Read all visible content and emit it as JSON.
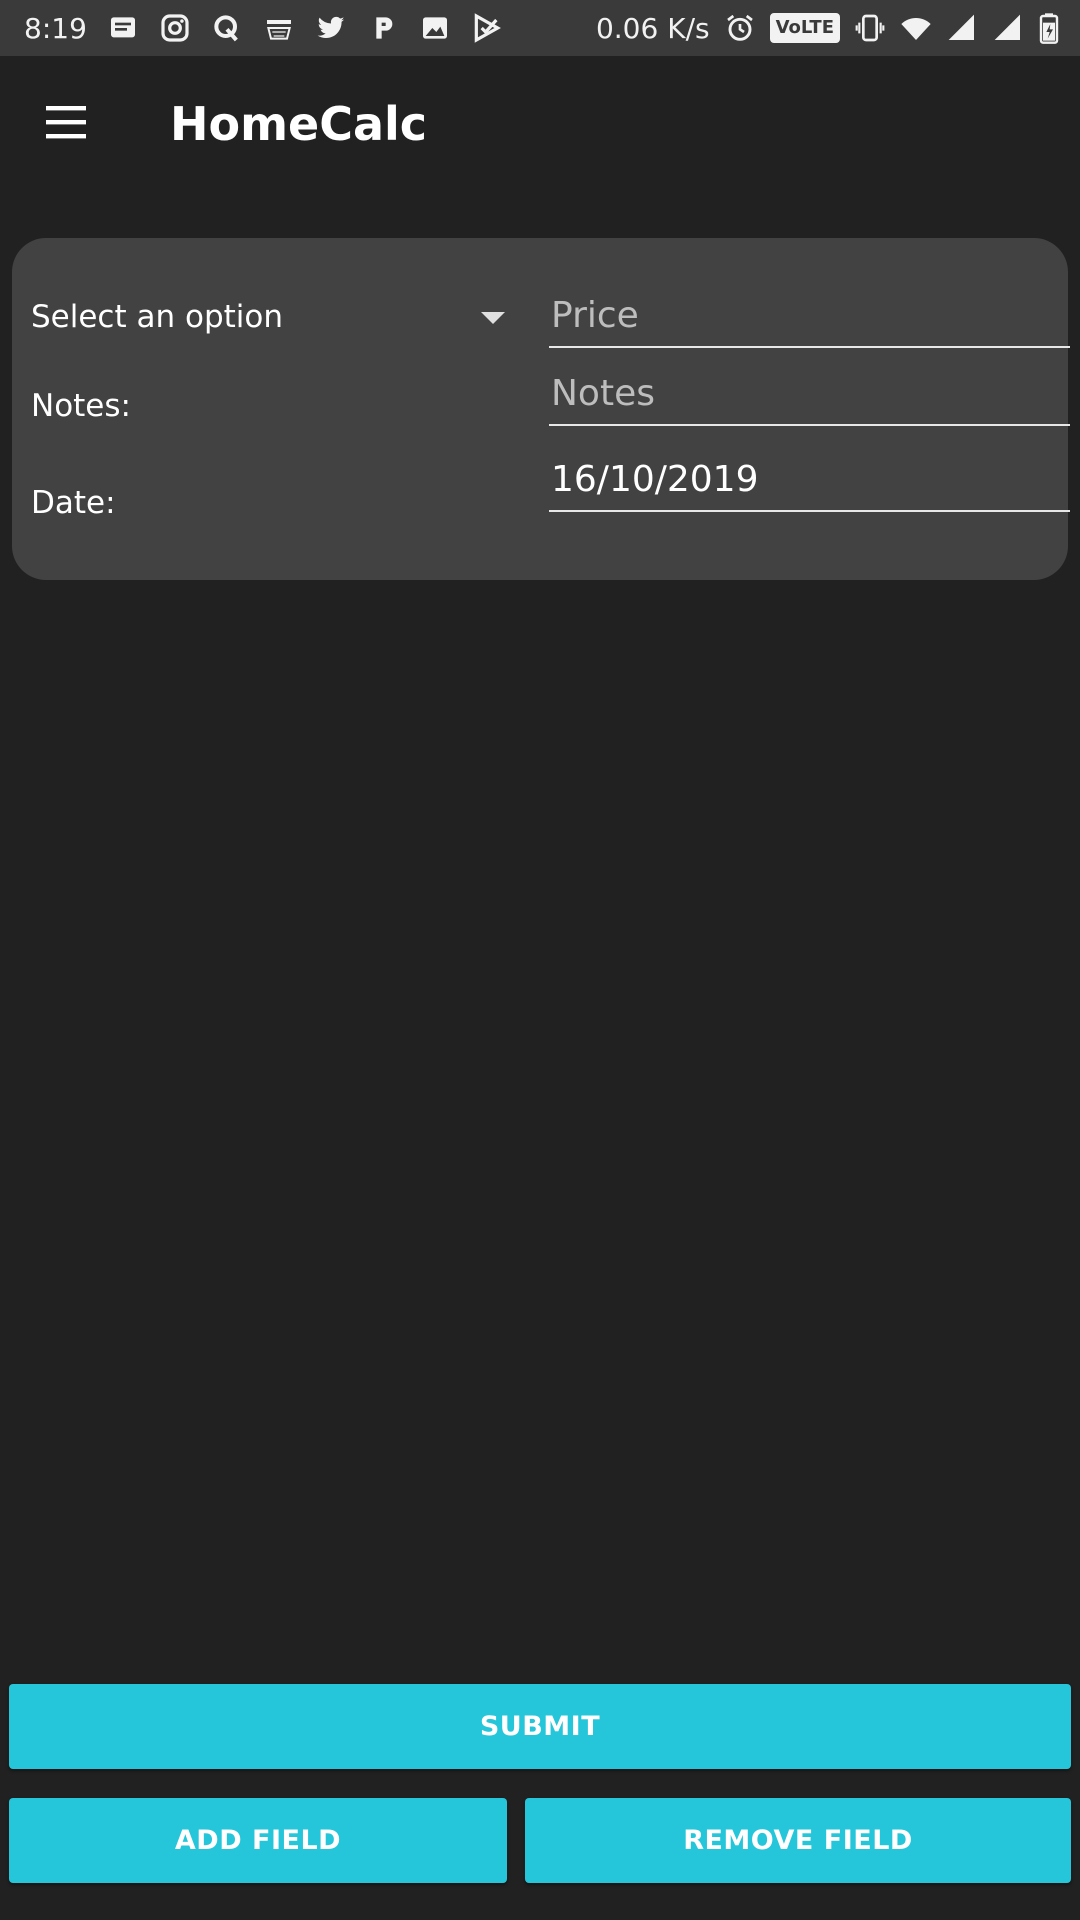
{
  "status_bar": {
    "time": "8:19",
    "network_speed": "0.06 K/s",
    "volte": "VoLTE",
    "left_icons": [
      "message-icon",
      "instagram-icon",
      "quora-icon",
      "amazon-icon",
      "twitter-icon",
      "paytm-icon",
      "image-icon",
      "check-icon"
    ],
    "right_icons": [
      "alarm-icon",
      "volte-icon",
      "vibrate-icon",
      "wifi-icon",
      "signal-icon",
      "signal-icon",
      "battery-icon"
    ]
  },
  "app_bar": {
    "menu_icon": "menu-icon",
    "title": "HomeCalc"
  },
  "form": {
    "category_select": {
      "selected": "Select an option"
    },
    "price": {
      "placeholder": "Price",
      "value": ""
    },
    "notes_label": "Notes:",
    "notes": {
      "placeholder": "Notes",
      "value": ""
    },
    "date_label": "Date:",
    "date": {
      "value": "16/10/2019"
    }
  },
  "buttons": {
    "submit": "SUBMIT",
    "add_field": "ADD FIELD",
    "remove_field": "REMOVE FIELD"
  },
  "colors": {
    "background": "#212121",
    "card": "#424242",
    "accent": "#26c6da",
    "status_bar": "#3a3a3a"
  }
}
